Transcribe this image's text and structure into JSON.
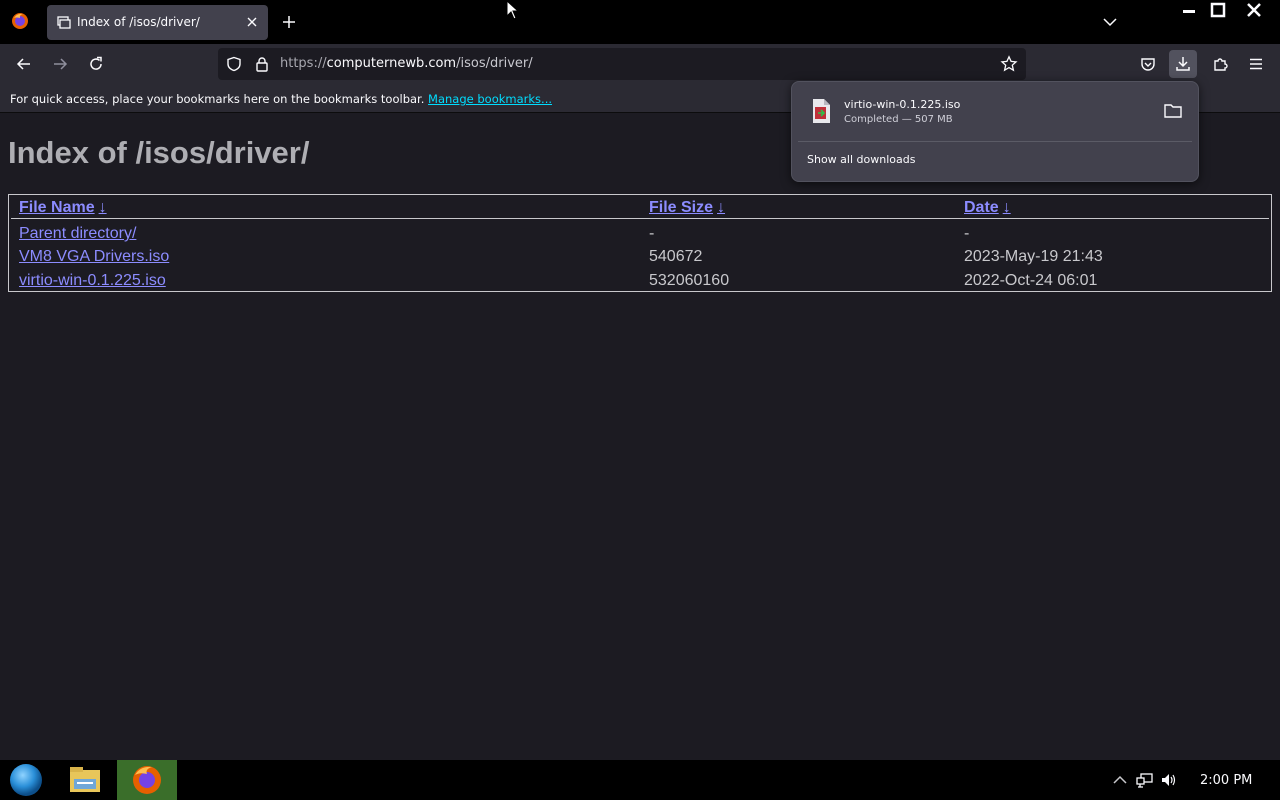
{
  "browser": {
    "tab": {
      "title": "Index of /isos/driver/",
      "favicon": "directory-icon"
    },
    "url": {
      "scheme": "https://",
      "host": "computernewb.com",
      "path": "/isos/driver/"
    },
    "bookmarks_bar": {
      "message": "For quick access, place your bookmarks here on the bookmarks toolbar.",
      "link": "Manage bookmarks..."
    }
  },
  "page": {
    "heading": "Index of /isos/driver/",
    "columns": [
      {
        "label": "File Name",
        "sort": "↓"
      },
      {
        "label": "File Size",
        "sort": "↓"
      },
      {
        "label": "Date",
        "sort": "↓"
      }
    ],
    "rows": [
      {
        "name": "Parent directory/",
        "size": "-",
        "date": "-"
      },
      {
        "name": "VM8 VGA Drivers.iso",
        "size": "540672",
        "date": "2023-May-19 21:43"
      },
      {
        "name": "virtio-win-0.1.225.iso",
        "size": "532060160",
        "date": "2022-Oct-24 06:01"
      }
    ]
  },
  "downloads_panel": {
    "item": {
      "filename": "virtio-win-0.1.225.iso",
      "status": "Completed — 507 MB"
    },
    "show_all": "Show all downloads"
  },
  "taskbar": {
    "clock": "2:00 PM"
  },
  "colors": {
    "link": "#8c8cff",
    "accent": "#00ddff",
    "firefox_task_bg": "#3a6e2a"
  }
}
